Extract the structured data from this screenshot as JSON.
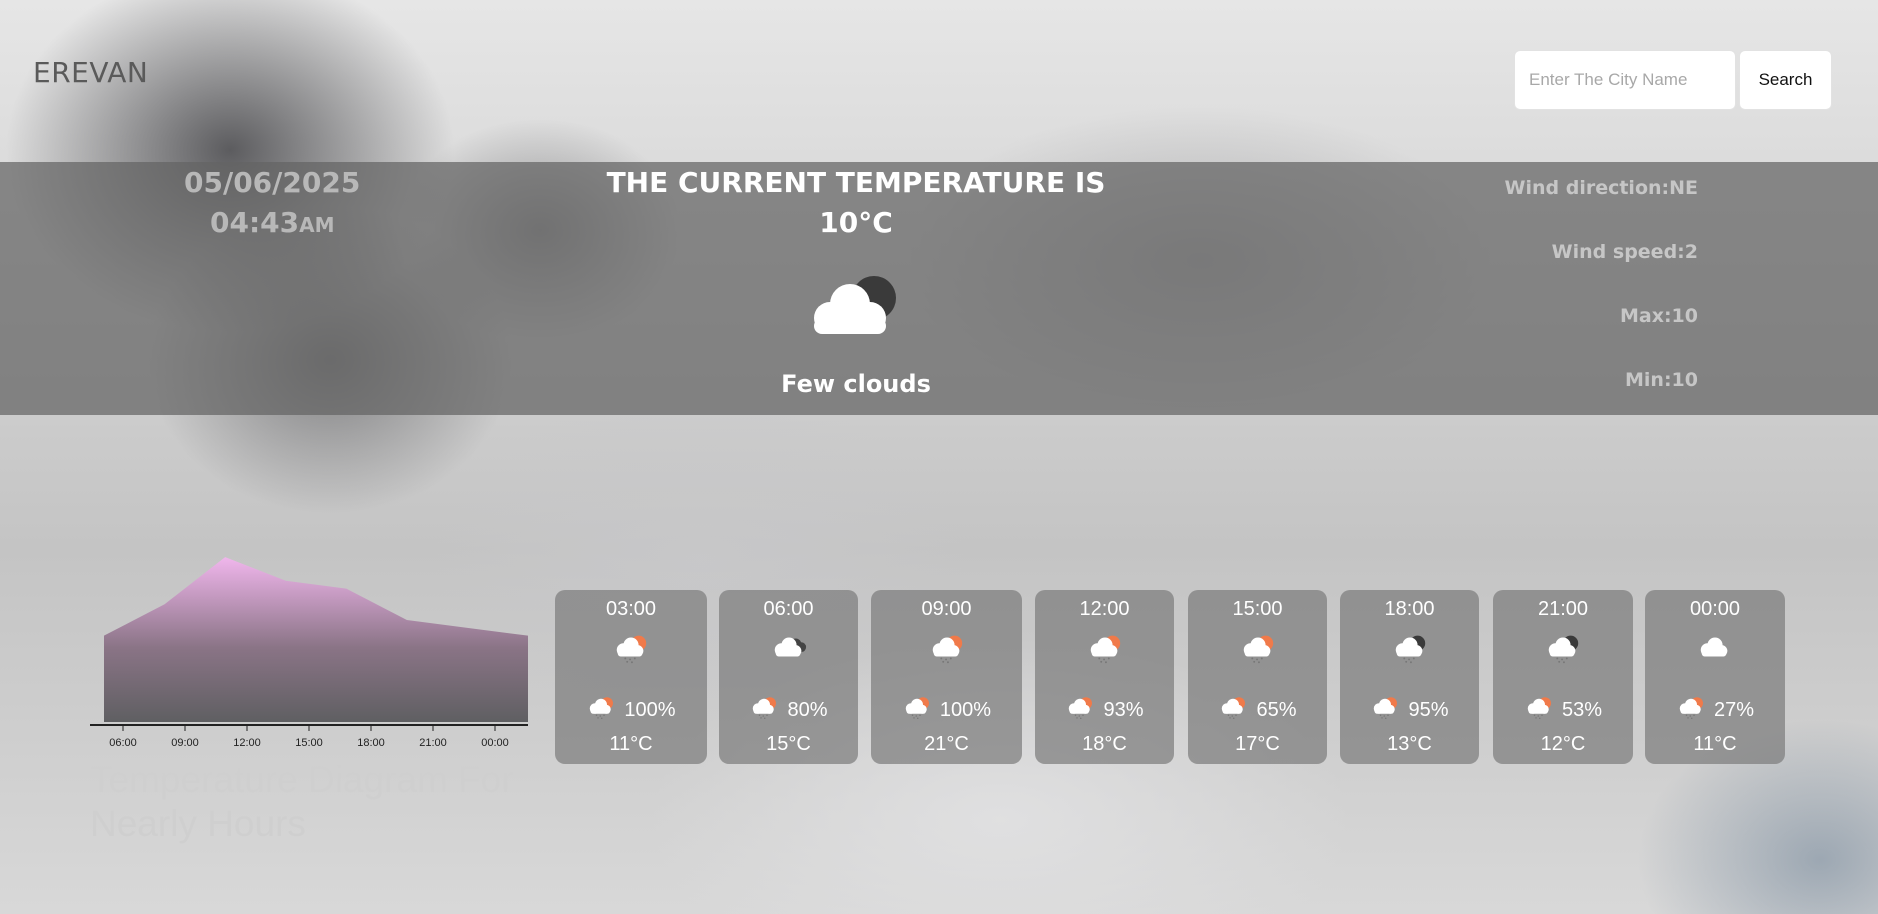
{
  "header": {
    "city": "EREVAN",
    "search_placeholder": "Enter The City Name",
    "search_label": "Search"
  },
  "current": {
    "date": "05/06/2025",
    "time": "04:43",
    "ampm": "AM",
    "label": "THE CURRENT TEMPERATURE IS",
    "temperature": "10°C",
    "description": "Few clouds",
    "icon": "few-clouds-night-icon",
    "wind_direction": "Wind direction:NE",
    "wind_speed": "Wind speed:2",
    "max": "Max:10",
    "min": "Min:10"
  },
  "chart_data": {
    "type": "area",
    "title": "Temperature Diagram For Nearly Hours",
    "categories": [
      "06:00",
      "09:00",
      "12:00",
      "15:00",
      "18:00",
      "21:00",
      "00:00"
    ],
    "x_labels": [
      "06:00",
      "09:00",
      "12:00",
      "15:00",
      "18:00",
      "21:00",
      "00:00"
    ],
    "values": [
      11,
      15,
      21,
      18,
      17,
      13,
      12,
      11
    ],
    "fill_top": "#f0b6ec",
    "fill_bottom": "#5f5f62",
    "grid": false
  },
  "forecast": [
    {
      "time": "03:00",
      "icon": "rain-sun-icon",
      "pop": "100%",
      "temp": "11°C"
    },
    {
      "time": "06:00",
      "icon": "broken-clouds-icon",
      "pop": "80%",
      "temp": "15°C"
    },
    {
      "time": "09:00",
      "icon": "rain-sun-icon",
      "pop": "100%",
      "temp": "21°C"
    },
    {
      "time": "12:00",
      "icon": "rain-sun-icon",
      "pop": "93%",
      "temp": "18°C"
    },
    {
      "time": "15:00",
      "icon": "rain-sun-icon",
      "pop": "65%",
      "temp": "17°C"
    },
    {
      "time": "18:00",
      "icon": "rain-night-icon",
      "pop": "95%",
      "temp": "13°C"
    },
    {
      "time": "21:00",
      "icon": "rain-night-icon",
      "pop": "53%",
      "temp": "12°C"
    },
    {
      "time": "00:00",
      "icon": "cloud-icon",
      "pop": "27%",
      "temp": "11°C"
    }
  ],
  "colors": {
    "sun": "#f07a4a",
    "moon": "#3a3a3a",
    "cloud": "#ffffff",
    "rain": "#777777"
  }
}
